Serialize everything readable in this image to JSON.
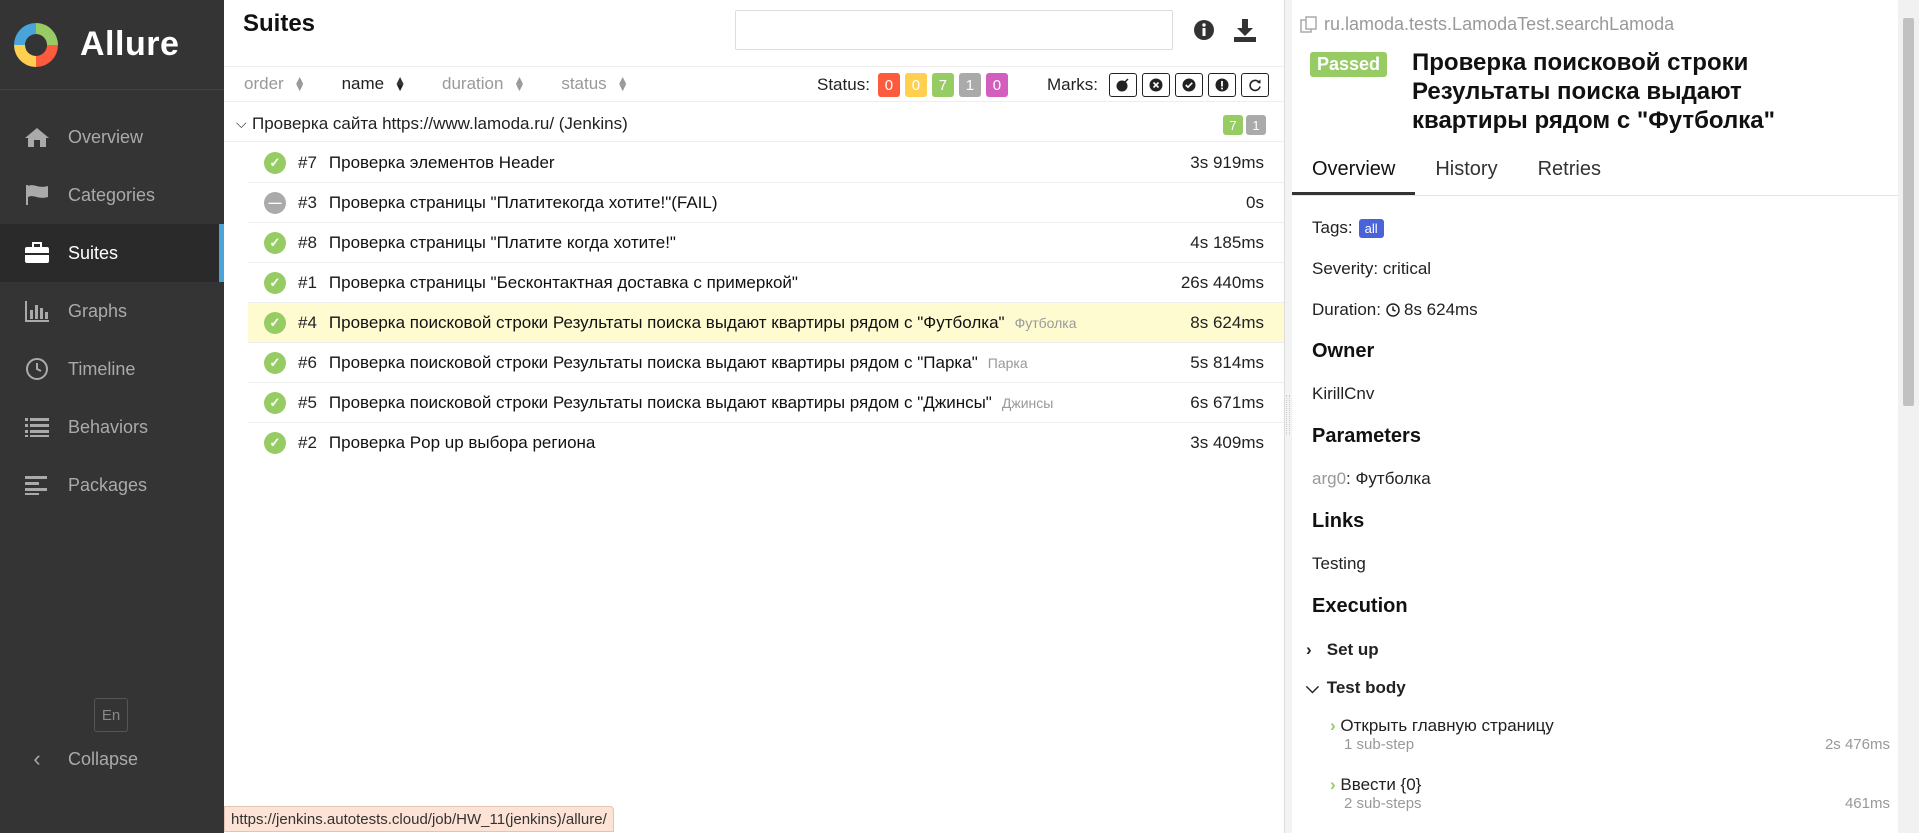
{
  "app": {
    "name": "Allure"
  },
  "sidebar": {
    "items": [
      {
        "label": "Overview",
        "icon": "home-icon",
        "active": false
      },
      {
        "label": "Categories",
        "icon": "flag-icon",
        "active": false
      },
      {
        "label": "Suites",
        "icon": "briefcase-icon",
        "active": true
      },
      {
        "label": "Graphs",
        "icon": "bar-chart-icon",
        "active": false
      },
      {
        "label": "Timeline",
        "icon": "clock-icon",
        "active": false
      },
      {
        "label": "Behaviors",
        "icon": "list-icon",
        "active": false
      },
      {
        "label": "Packages",
        "icon": "align-left-icon",
        "active": false
      }
    ],
    "language": "En",
    "collapse_label": "Collapse"
  },
  "main": {
    "title": "Suites",
    "search_placeholder": "",
    "sort": {
      "order": "order",
      "name": "name",
      "duration": "duration",
      "status": "status"
    },
    "status_label": "Status:",
    "status_badges": [
      {
        "value": "0",
        "color": "#fd5a3e"
      },
      {
        "value": "0",
        "color": "#ffd050"
      },
      {
        "value": "7",
        "color": "#97cc64"
      },
      {
        "value": "1",
        "color": "#aaaaaa"
      },
      {
        "value": "0",
        "color": "#d35ebe"
      }
    ],
    "marks_label": "Marks:",
    "group": {
      "name": "Проверка сайта https://www.lamoda.ru/ (Jenkins)",
      "passed": "7",
      "skipped": "1"
    },
    "tests": [
      {
        "num": "#7",
        "name": "Проверка элементов Header",
        "param": "",
        "duration": "3s 919ms",
        "status": "passed"
      },
      {
        "num": "#3",
        "name": "Проверка страницы \"Платитекогда хотите!\"(FAIL)",
        "param": "",
        "duration": "0s",
        "status": "skipped"
      },
      {
        "num": "#8",
        "name": "Проверка страницы \"Платите когда хотите!\"",
        "param": "",
        "duration": "4s 185ms",
        "status": "passed"
      },
      {
        "num": "#1",
        "name": "Проверка страницы \"Бесконтактная доставка с примеркой\"",
        "param": "",
        "duration": "26s 440ms",
        "status": "passed"
      },
      {
        "num": "#4",
        "name": "Проверка поисковой строки Результаты поиска выдают квартиры рядом с \"Футболка\"",
        "param": "Футболка",
        "duration": "8s 624ms",
        "status": "passed"
      },
      {
        "num": "#6",
        "name": "Проверка поисковой строки Результаты поиска выдают квартиры рядом с \"Парка\"",
        "param": "Парка",
        "duration": "5s 814ms",
        "status": "passed"
      },
      {
        "num": "#5",
        "name": "Проверка поисковой строки Результаты поиска выдают квартиры рядом с \"Джинсы\"",
        "param": "Джинсы",
        "duration": "6s 671ms",
        "status": "passed"
      },
      {
        "num": "#2",
        "name": "Проверка Pop up выбора региона",
        "param": "",
        "duration": "3s 409ms",
        "status": "passed"
      }
    ],
    "status_url": "https://jenkins.autotests.cloud/job/HW_11(jenkins)/allure/"
  },
  "detail": {
    "full_name": "ru.lamoda.tests.LamodaTest.searchLamoda",
    "status": "Passed",
    "title": "Проверка поисковой строки Результаты поиска выдают квартиры рядом с \"Футболка\"",
    "tabs": [
      "Overview",
      "History",
      "Retries"
    ],
    "tags_label": "Tags:",
    "tag": "all",
    "severity_label": "Severity:",
    "severity": "critical",
    "duration_label": "Duration:",
    "duration": "8s 624ms",
    "owner_heading": "Owner",
    "owner": "KirillCnv",
    "parameters_heading": "Parameters",
    "param_name": "arg0",
    "param_value": "Футболка",
    "links_heading": "Links",
    "link": "Testing",
    "execution_heading": "Execution",
    "setup_label": "Set up",
    "test_body_label": "Test body",
    "steps": [
      {
        "name": "Открыть главную страницу",
        "sub": "1 sub-step",
        "duration": "2s 476ms"
      },
      {
        "name": "Ввести {0}",
        "sub": "2 sub-steps",
        "duration": "461ms"
      }
    ]
  }
}
